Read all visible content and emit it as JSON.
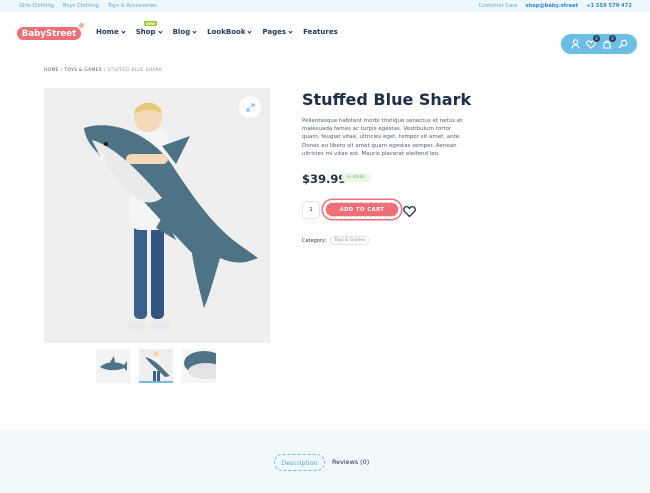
{
  "topbar": {
    "links": [
      "Girls Clothing",
      "Boys Clothing",
      "Toys & Accessories"
    ],
    "support_label": "Customer Care",
    "email": "shop@baby.street",
    "phone": "+1 559 579 472"
  },
  "header": {
    "logo_text": "BabyStreet",
    "nav": [
      {
        "label": "Home",
        "dropdown": true
      },
      {
        "label": "Shop",
        "dropdown": true,
        "badge": "new"
      },
      {
        "label": "Blog",
        "dropdown": true
      },
      {
        "label": "LookBook",
        "dropdown": true
      },
      {
        "label": "Pages",
        "dropdown": true
      },
      {
        "label": "Features",
        "dropdown": false
      }
    ],
    "actions": {
      "account_icon": "user-icon",
      "wishlist_icon": "heart-icon",
      "wishlist_count": "0",
      "cart_icon": "bag-icon",
      "cart_count": "0",
      "search_icon": "search-icon"
    }
  },
  "breadcrumb": [
    "HOME",
    "TOYS & GAMES",
    "STUFFED BLUE SHARK"
  ],
  "product": {
    "title": "Stuffed Blue Shark",
    "description": "Pellentesque habitant morbi tristique senectus et netus et malesuada fames ac turpis egestas. Vestibulum tortor quam, feugiat vitae, ultricies eget, tempor sit amet, ante. Donec eu libero sit amet quam egestas semper. Aenean ultricies mi vitae est. Mauris placerat eleifend leo.",
    "price": "$39.99",
    "stock": "In stock",
    "quantity": "1",
    "add_to_cart": "ADD TO CART",
    "category_label": "Category:",
    "category": "Toys & Games"
  },
  "tabs": {
    "description": "Description",
    "reviews": "Reviews (0)"
  },
  "colors": {
    "accent_pink": "#ee6f78",
    "accent_blue": "#6bbde6",
    "heading": "#1f2f46"
  }
}
